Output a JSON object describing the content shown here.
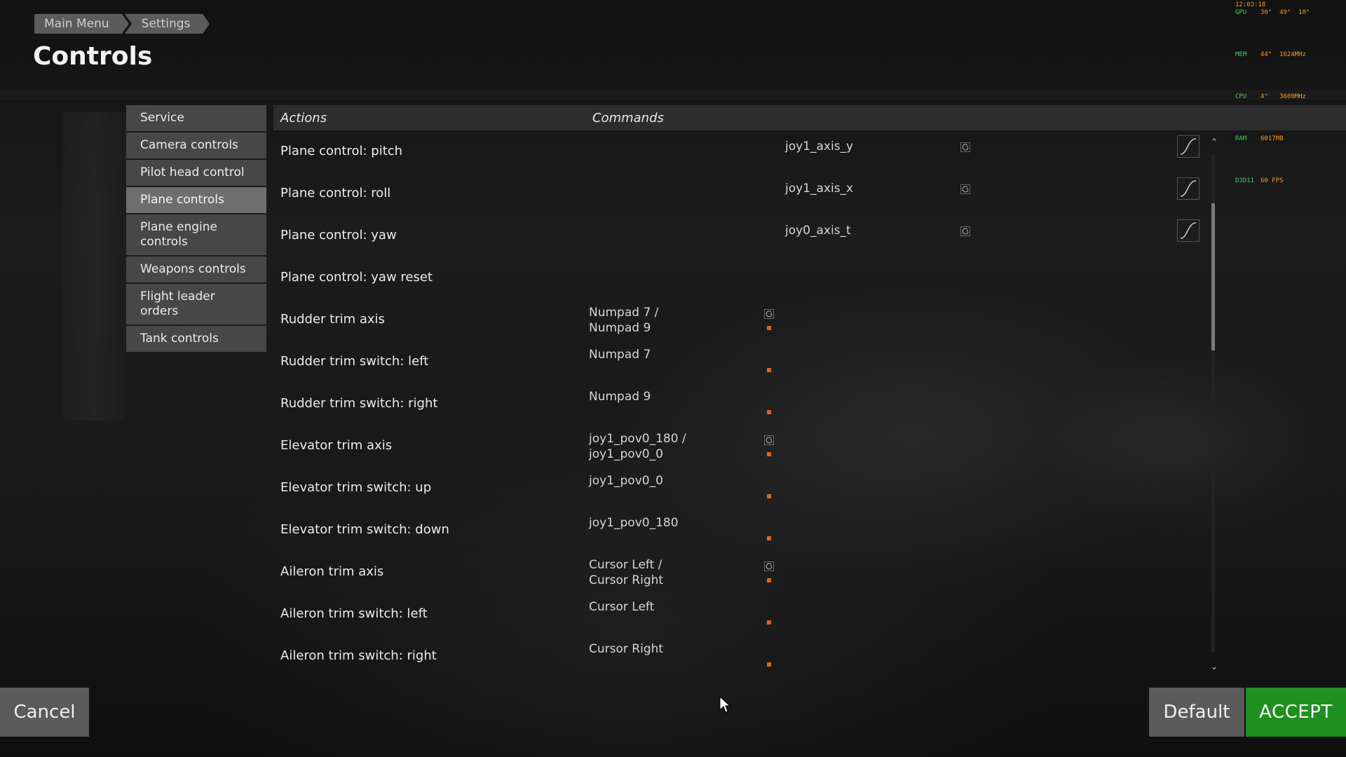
{
  "breadcrumb": [
    "Main Menu",
    "Settings"
  ],
  "page_title": "Controls",
  "hw_monitor": {
    "clock": "12:03:18",
    "rows": [
      {
        "key": "GPU",
        "value": "30°  49°  10°"
      },
      {
        "key": "MEM",
        "value": "44°  1624MHz"
      },
      {
        "key": "CPU",
        "value": "4°   3600MHz"
      },
      {
        "key": "RAM",
        "value": "6017MB"
      },
      {
        "key": "D3D11",
        "value": "60 FPS"
      }
    ]
  },
  "categories": [
    {
      "label": "Service",
      "active": false
    },
    {
      "label": "Camera controls",
      "active": false
    },
    {
      "label": "Pilot head control",
      "active": false
    },
    {
      "label": "Plane controls",
      "active": true
    },
    {
      "label": "Plane engine controls",
      "active": false
    },
    {
      "label": "Weapons controls",
      "active": false
    },
    {
      "label": "Flight leader orders",
      "active": false
    },
    {
      "label": "Tank controls",
      "active": false
    }
  ],
  "table": {
    "header_actions": "Actions",
    "header_commands": "Commands"
  },
  "rows": [
    {
      "action": "Plane control: pitch",
      "command": "",
      "axis": "joy1_axis_y",
      "has_curve": true
    },
    {
      "action": "Plane control: roll",
      "command": "",
      "axis": "joy1_axis_x",
      "has_curve": true
    },
    {
      "action": "Plane control: yaw",
      "command": "",
      "axis": "joy0_axis_t",
      "has_curve": true
    },
    {
      "action": "Plane control: yaw reset",
      "command": "",
      "axis": "",
      "has_curve": false
    },
    {
      "action": "Rudder trim axis",
      "command": "Numpad 7 /\nNumpad 9",
      "axis": "",
      "has_curve": false
    },
    {
      "action": "Rudder trim switch: left",
      "command": "Numpad 7",
      "axis": "",
      "has_curve": false
    },
    {
      "action": "Rudder trim switch: right",
      "command": "Numpad 9",
      "axis": "",
      "has_curve": false
    },
    {
      "action": "Elevator trim axis",
      "command": "joy1_pov0_180 /\njoy1_pov0_0",
      "axis": "",
      "has_curve": false
    },
    {
      "action": "Elevator trim switch: up",
      "command": "joy1_pov0_0",
      "axis": "",
      "has_curve": false
    },
    {
      "action": "Elevator trim switch: down",
      "command": "joy1_pov0_180",
      "axis": "",
      "has_curve": false
    },
    {
      "action": "Aileron trim axis",
      "command": "Cursor Left /\nCursor Right",
      "axis": "",
      "has_curve": false
    },
    {
      "action": "Aileron trim switch: left",
      "command": "Cursor Left",
      "axis": "",
      "has_curve": false
    },
    {
      "action": "Aileron trim switch: right",
      "command": "Cursor Right",
      "axis": "",
      "has_curve": false
    }
  ],
  "buttons": {
    "cancel": "Cancel",
    "default": "Default",
    "accept": "ACCEPT"
  },
  "colors": {
    "accept": "#1f8f1f",
    "binding_dot": "#e0641e",
    "active_category": "#6e6e6e"
  }
}
